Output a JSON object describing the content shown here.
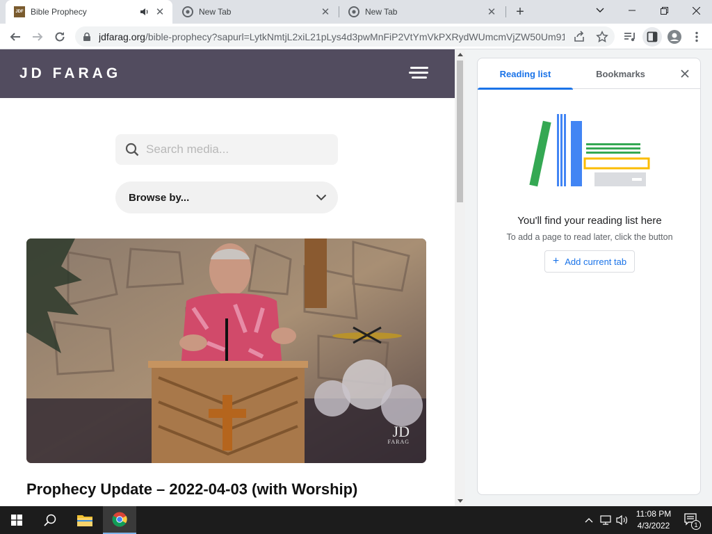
{
  "browser": {
    "tabs": [
      {
        "title": "Bible Prophecy",
        "favicon_text": "JDF",
        "active": true,
        "audio": true
      },
      {
        "title": "New Tab",
        "active": false
      },
      {
        "title": "New Tab",
        "active": false
      }
    ],
    "new_tab_label": "+",
    "address_bar": {
      "host": "jdfarag.org",
      "path": "/bible-prophecy?sapurl=LytkNmtjL2xiL21pLys4d3pwMnFiP2VtYmVkPXRydWUmcmVjZW50Um91..."
    }
  },
  "page": {
    "site_logo": "JD FARAG",
    "search": {
      "placeholder": "Search media..."
    },
    "browse": {
      "label": "Browse by..."
    },
    "video": {
      "title": "Prophecy Update – 2022-04-03 (with Worship)",
      "watermark_top": "JD",
      "watermark_bottom": "FARAG"
    }
  },
  "side_panel": {
    "tabs": [
      {
        "label": "Reading list",
        "active": true
      },
      {
        "label": "Bookmarks",
        "active": false
      }
    ],
    "empty_title": "You'll find your reading list here",
    "empty_subtitle": "To add a page to read later, click the button",
    "add_button_label": "Add current tab"
  },
  "taskbar": {
    "time": "11:08 PM",
    "date": "4/3/2022",
    "notification_count": "1"
  },
  "colors": {
    "site_header": "#524c5f",
    "accent_blue": "#1a73e8",
    "tab_strip": "#dee1e6"
  }
}
